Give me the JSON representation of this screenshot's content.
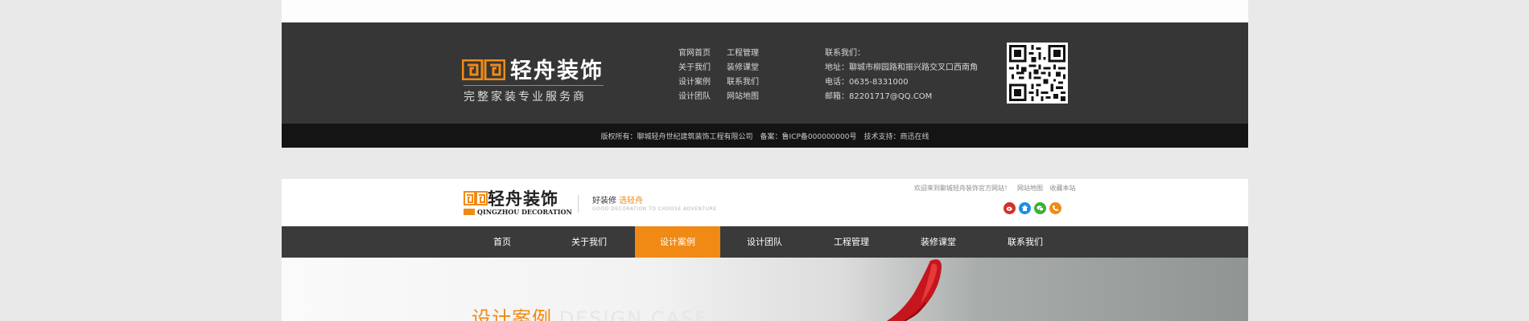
{
  "footer": {
    "logo_name": "轻舟装饰",
    "logo_slogan": "完整家装专业服务商",
    "links": [
      "官网首页",
      "工程管理",
      "关于我们",
      "装修课堂",
      "设计案例",
      "联系我们",
      "设计团队",
      "网站地图"
    ],
    "contact": {
      "heading": "联系我们：",
      "address": "地址：聊城市柳园路和振兴路交叉口西南角",
      "phone": "电话：0635-8331000",
      "email": "邮箱：82201717@QQ.COM"
    },
    "copyright": "版权所有：聊城轻舟世纪建筑装饰工程有限公司　备案：鲁ICP备000000000号　技术支持：商迅在线"
  },
  "header": {
    "logo_name": "轻舟装饰",
    "logo_sub": "QINGZHOU DECORATION",
    "tagline_prefix": "好装修",
    "tagline_highlight": "选轻舟",
    "tagline_en": "GOOD DECORATION TO CHOOSE ADVENTURE",
    "welcome": "欢迎来到聊城轻舟装饰官方网站！",
    "toplinks": [
      "网站地图",
      "收藏本站"
    ],
    "social": [
      {
        "icon": "weibo-icon",
        "color": "#d0312d"
      },
      {
        "icon": "qzone-icon",
        "color": "#1e8fe0"
      },
      {
        "icon": "wechat-icon",
        "color": "#3cb034"
      },
      {
        "icon": "phone-icon",
        "color": "#f08a15"
      }
    ]
  },
  "nav": {
    "items": [
      "首页",
      "关于我们",
      "设计案例",
      "设计团队",
      "工程管理",
      "装修课堂",
      "联系我们"
    ],
    "active": "设计案例"
  },
  "banner": {
    "title_cn": "设计案例",
    "title_en": "DESIGN CASE"
  },
  "colors": {
    "accent": "#f08a15",
    "footer_bg": "#363636",
    "copyright_bg": "#141414",
    "nav_bg": "#3a3a3a"
  }
}
